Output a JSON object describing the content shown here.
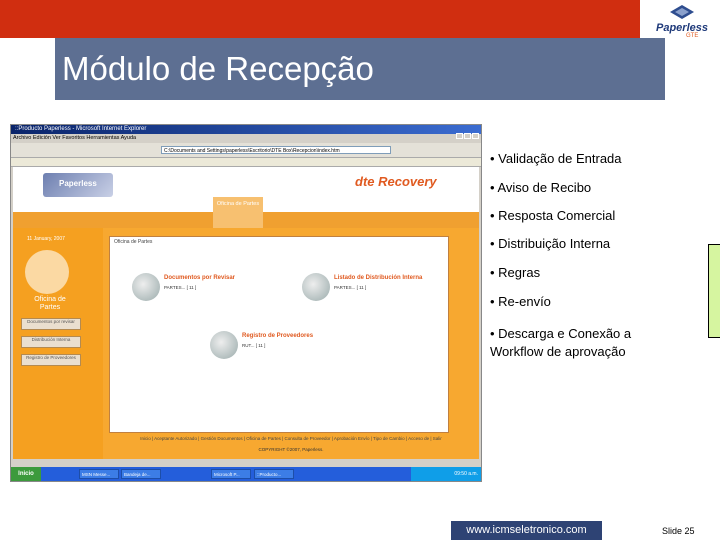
{
  "slide": {
    "title": "Módulo de Recepção",
    "logo_text": "Paperless",
    "logo_sub": "GTE",
    "bullets": [
      "• Validação de Entrada",
      "• Aviso de Recibo",
      "• Resposta Comercial",
      "• Distribuição Interna",
      "• Regras",
      "• Re-envío",
      "• Descarga e Conexão a",
      "Workflow de aprovação"
    ],
    "footer_url": "www.icmseletronico.com",
    "slide_number": "Slide 25"
  },
  "screenshot": {
    "window_title": "::Producto Paperless - Microsoft Internet Explorer",
    "menu": "Archivo  Edición  Ver  Favoritos  Herramientas  Ayuda",
    "address": "C:\\Documents and Settings\\paperless\\Escritorio\\DTE Box\\Recepcion\\index.htm",
    "logo": "Paperless",
    "dte_logo": "dte Recovery",
    "nav_active": "Oficina de Partes",
    "date": "11 January, 2007",
    "oficina_label": "Oficina de Partes",
    "left_buttons": [
      "Documentos por revisar",
      "Distribución Interna",
      "Registro de Proveedores"
    ],
    "inner_tab": "Oficina de Partes",
    "items": [
      {
        "label": "Documentos por Revisar",
        "sub": "PARTES... [ 11 ]"
      },
      {
        "label": "Listado de Distribución Interna",
        "sub": "PARTES... [ 11 ]"
      },
      {
        "label": "Registro de Proveedores",
        "sub": "RUT... [ 11 ]"
      }
    ],
    "footer_links": "Inicio | Aceptante Autorizado | Gestión Documentos | Oficina de Partes | Consulta de Proveedor | Aprobación Envío | Tipo de Cambio | Acceso de | Salir",
    "copyright": "COPYRIGHT ©2007, Paperless.",
    "taskbar": [
      "Inicio",
      "MSN Messe...",
      "Bandeja de...",
      "Microsoft P...",
      "::Producto..."
    ],
    "tray": "09:50 a.m."
  },
  "colors": {
    "top_bar": "#d02e10",
    "title_box": "#5d6f92",
    "url_box": "#2e4374",
    "accent_orange": "#f5a020"
  }
}
